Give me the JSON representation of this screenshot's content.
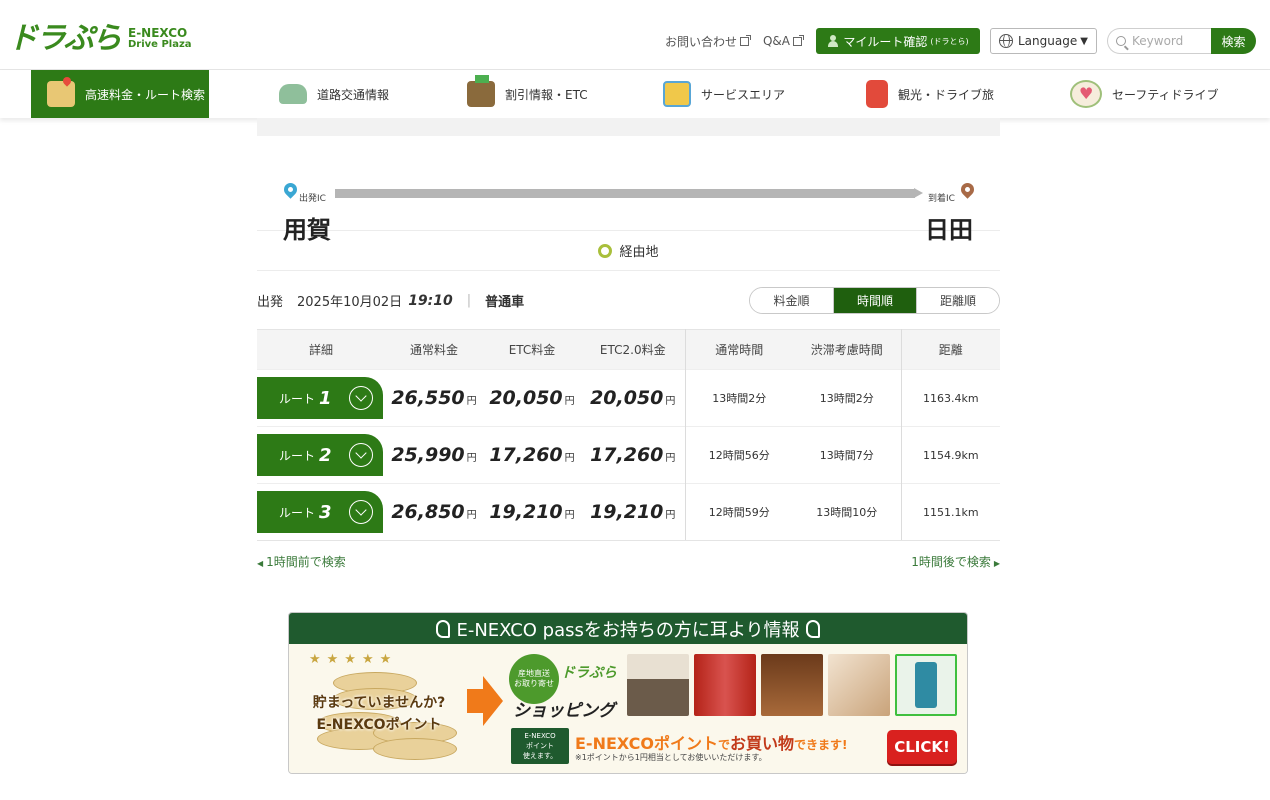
{
  "header": {
    "logo_main": "ドラぷら",
    "logo_sub_1": "E-NEXCO",
    "logo_sub_2": "Drive Plaza",
    "contact_label": "お問い合わせ",
    "qa_label": "Q&A",
    "myroute_label": "マイルート確認",
    "myroute_sub": "(ドラとら)",
    "language_label": "Language",
    "search_placeholder": "Keyword",
    "search_button": "検索"
  },
  "nav": {
    "items": [
      {
        "label": "高速料金・ルート検索",
        "icon": "map-pin-icon"
      },
      {
        "label": "道路交通情報",
        "icon": "car-icon"
      },
      {
        "label": "割引情報・ETC",
        "icon": "wallet-icon"
      },
      {
        "label": "サービスエリア",
        "icon": "parking-icon"
      },
      {
        "label": "観光・ドライブ旅",
        "icon": "suitcase-icon"
      },
      {
        "label": "セーフティドライブ",
        "icon": "heart-icon"
      }
    ]
  },
  "route": {
    "start_label": "出発IC",
    "end_label": "到着IC",
    "start_name": "用賀",
    "end_name": "日田",
    "via_label": "経由地"
  },
  "conditions": {
    "depart_label": "出発",
    "date": "2025年10月02日",
    "time": "19:10",
    "vehicle": "普通車"
  },
  "sort": {
    "options": [
      "料金順",
      "時間順",
      "距離順"
    ],
    "active": "時間順"
  },
  "table": {
    "headers": [
      "詳細",
      "通常料金",
      "ETC料金",
      "ETC2.0料金",
      "通常時間",
      "渋滞考慮時間",
      "距離"
    ],
    "yen": "円",
    "route_prefix": "ルート",
    "rows": [
      {
        "num": "1",
        "normal": "26,550",
        "etc": "20,050",
        "etc2": "20,050",
        "time": "13時間2分",
        "jam_time": "13時間2分",
        "distance": "1163.4km"
      },
      {
        "num": "2",
        "normal": "25,990",
        "etc": "17,260",
        "etc2": "17,260",
        "time": "12時間56分",
        "jam_time": "13時間7分",
        "distance": "1154.9km"
      },
      {
        "num": "3",
        "normal": "26,850",
        "etc": "19,210",
        "etc2": "19,210",
        "time": "12時間59分",
        "jam_time": "13時間10分",
        "distance": "1151.1km"
      }
    ]
  },
  "time_nav": {
    "prev": "1時間前で検索",
    "next": "1時間後で検索"
  },
  "banner": {
    "title": "E-NEXCO passをお持ちの方に耳より情報",
    "coin_text_1": "貯まっていませんか?",
    "coin_text_2": "E-NEXCOポイント",
    "shop_badge_1": "産地直送",
    "shop_badge_2": "お取り寄せ",
    "shop_dora": "ドラぷら",
    "shop_name": "ショッピング",
    "point_badge_1": "E-NEXCO",
    "point_badge_2": "ポイント",
    "point_badge_3": "使えます。",
    "point_text_1": "E-NEXCOポイント",
    "point_text_2": "で",
    "point_text_3": "お買い物",
    "point_text_4": "できます!",
    "point_note": "※1ポイントから1円相当としてお使いいただけます。",
    "click_label": "CLICK!"
  }
}
